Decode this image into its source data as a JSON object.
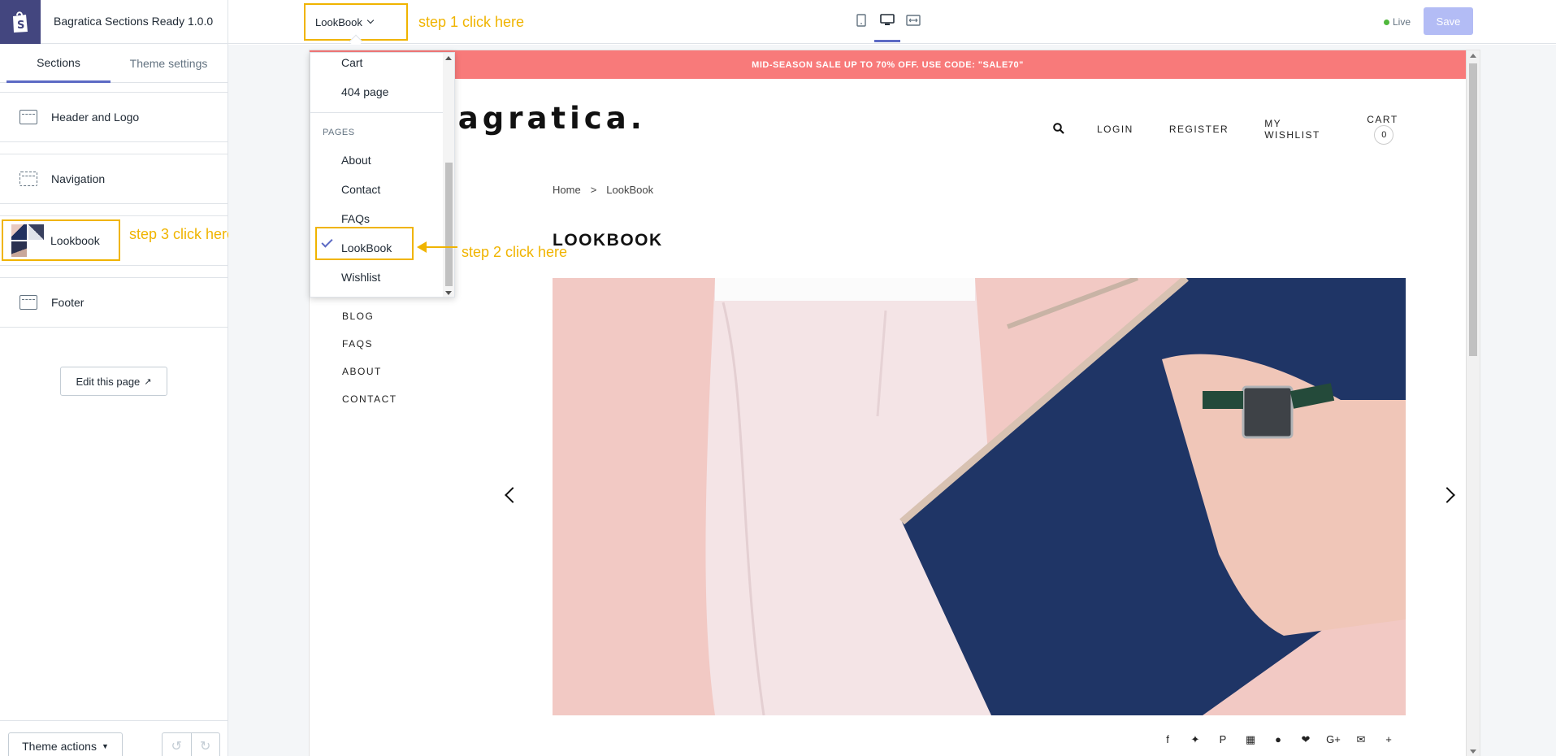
{
  "topbar": {
    "store_title": "Bagratica Sections Ready 1.0.0",
    "page_select": "LookBook",
    "live_label": "Live",
    "save_label": "Save"
  },
  "annotations": {
    "step1": "step 1 click here",
    "step2": "step 2 click here",
    "step3": "step 3 click here"
  },
  "sidebar": {
    "tabs": [
      "Sections",
      "Theme settings"
    ],
    "sections": [
      "Header and Logo",
      "Navigation",
      "Lookbook",
      "Footer"
    ],
    "edit_page": "Edit this page",
    "theme_actions": "Theme actions"
  },
  "dropdown": {
    "items_top": [
      "Cart",
      "404 page"
    ],
    "pages_header": "PAGES",
    "pages": [
      "About",
      "Contact",
      "FAQs",
      "LookBook",
      "Wishlist"
    ],
    "selected": "LookBook"
  },
  "preview": {
    "announcement": "MID-SEASON SALE UP TO 70% OFF. USE CODE: \"SALE70\"",
    "brand": "The Bagratica.",
    "nav": [
      "LOGIN",
      "REGISTER",
      "MY WISHLIST",
      "CART"
    ],
    "cart_count": "0",
    "breadcrumb": [
      "Home",
      ">",
      "LookBook"
    ],
    "title": "LOOKBOOK",
    "side_menu": [
      "BLOG",
      "FAQS",
      "ABOUT",
      "CONTACT"
    ]
  },
  "colors": {
    "accent": "#5c6ac4",
    "annotation": "#f0b400",
    "announcement_bg": "#f87a7a",
    "shop_bar": "#43467f"
  },
  "icons": {
    "social": [
      "facebook-icon",
      "twitter-icon",
      "pinterest-icon",
      "grid-icon",
      "snapchat-icon",
      "heart-icon",
      "google-plus-icon",
      "email-icon",
      "plus-icon"
    ]
  }
}
